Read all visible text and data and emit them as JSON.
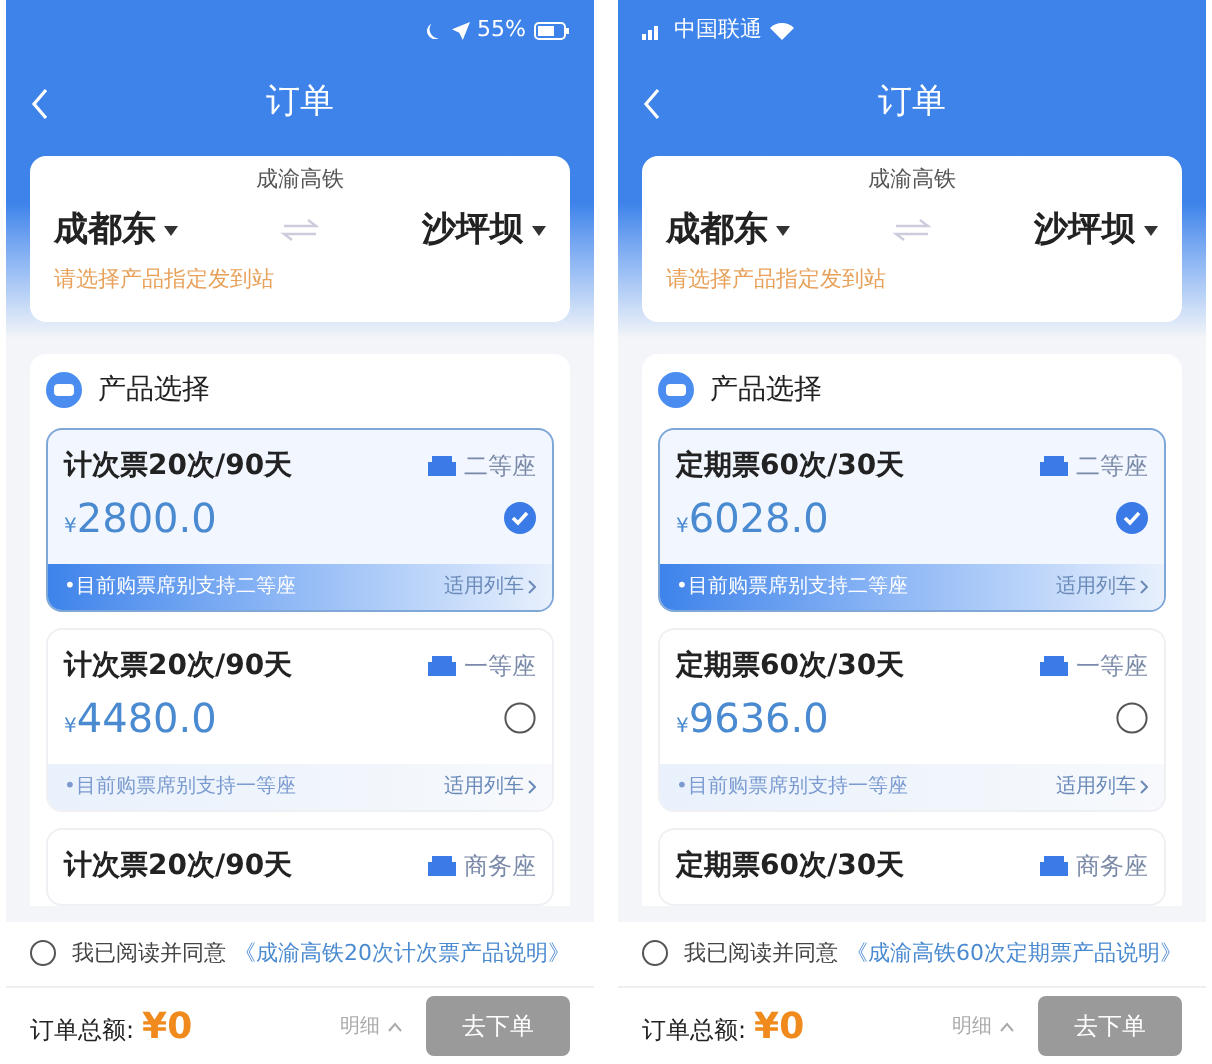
{
  "phones": [
    {
      "status_bar": {
        "battery": "55%"
      },
      "title": "订单",
      "route": {
        "line": "成渝高铁",
        "from": "成都东",
        "to": "沙坪坝",
        "hint": "请选择产品指定发到站"
      },
      "section_title": "产品选择",
      "products": [
        {
          "name": "计次票20次/90天",
          "seat": "二等座",
          "currency": "¥",
          "price": "2800.0",
          "selected": true,
          "note": "•目前购票席别支持二等座",
          "link": "适用列车"
        },
        {
          "name": "计次票20次/90天",
          "seat": "一等座",
          "currency": "¥",
          "price": "4480.0",
          "selected": false,
          "note": "•目前购票席别支持一等座",
          "link": "适用列车"
        },
        {
          "name": "计次票20次/90天",
          "seat": "商务座"
        }
      ],
      "agreement": {
        "checked": false,
        "text": "我已阅读并同意",
        "link": "《成渝高铁20次计次票产品说明》"
      },
      "footer": {
        "total_label": "订单总额:",
        "total": "¥0",
        "detail": "明细",
        "button": "去下单"
      }
    },
    {
      "status_bar": {
        "carrier": "中国联通"
      },
      "title": "订单",
      "route": {
        "line": "成渝高铁",
        "from": "成都东",
        "to": "沙坪坝",
        "hint": "请选择产品指定发到站"
      },
      "section_title": "产品选择",
      "products": [
        {
          "name": "定期票60次/30天",
          "seat": "二等座",
          "currency": "¥",
          "price": "6028.0",
          "selected": true,
          "note": "•目前购票席别支持二等座",
          "link": "适用列车"
        },
        {
          "name": "定期票60次/30天",
          "seat": "一等座",
          "currency": "¥",
          "price": "9636.0",
          "selected": false,
          "note": "•目前购票席别支持一等座",
          "link": "适用列车"
        },
        {
          "name": "定期票60次/30天",
          "seat": "商务座"
        }
      ],
      "agreement": {
        "checked": false,
        "text": "我已阅读并同意",
        "link": "《成渝高铁60次定期票产品说明》"
      },
      "footer": {
        "total_label": "订单总额:",
        "total": "¥0",
        "detail": "明细",
        "button": "去下单"
      }
    }
  ]
}
